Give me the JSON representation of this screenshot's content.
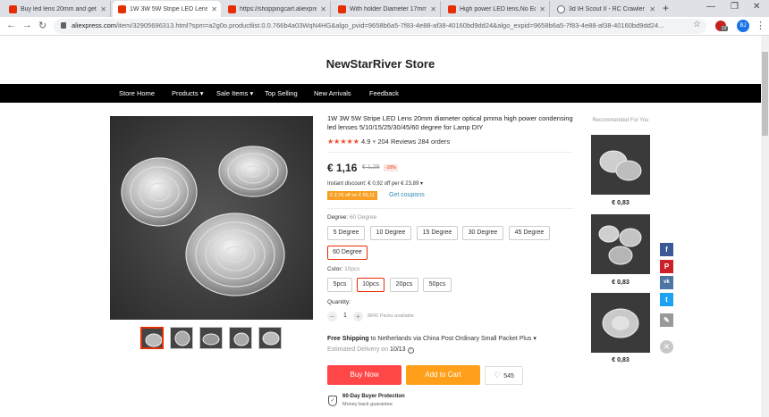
{
  "browser": {
    "tabs": [
      {
        "title": "Buy led lens 20mm and get fr",
        "icon": "aliexpress-icon"
      },
      {
        "title": "1W 3W 5W Stripe LED Lens 2",
        "icon": "aliexpress-icon"
      },
      {
        "title": "https://shoppingcart.aliexpres",
        "icon": "aliexpress-icon"
      },
      {
        "title": "With holder Diameter 17mm",
        "icon": "aliexpress-icon"
      },
      {
        "title": "High power LED lens,No Edg",
        "icon": "aliexpress-icon"
      },
      {
        "title": "3d IH Scout II - RC Crawler S",
        "icon": "globe-icon"
      }
    ],
    "url_host": "aliexpress.com",
    "url_rest": "/item/32905696313.html?spm=a2g0o.productlist.0.0.766b4a03WqN4HG&algo_pvid=9658b6a5-7f83-4e88-af38-40160bd9dd24&algo_expid=9658b6a5-7f83-4e88-af38-40160bd9dd24...",
    "extension_badge": "12",
    "profile_initials": "BJ"
  },
  "store": {
    "name": "NewStarRiver Store",
    "nav": [
      "Store Home",
      "Products",
      "Sale Items",
      "Top Selling",
      "New Arrivals",
      "Feedback"
    ]
  },
  "product": {
    "title": "1W 3W 5W Stripe LED Lens 20mm diameter optical pmma high power condensing led lenses 5/10/15/25/30/45/60 degree for Lamp DIY",
    "stars": "★★★★★",
    "rating": "4.9",
    "reviews": "204 Reviews",
    "orders": "284 orders",
    "price": "€ 1,16",
    "old_price": "€ 1,29",
    "discount": "-10%",
    "instant_discount": "Instant discount: € 0,92 off per € 23,89",
    "coupon_tag": "€ 2,76 off on € 55,11",
    "coupon_link": "Get coupons",
    "degree_label": "Degree:",
    "degree_value": "60 Degree",
    "degrees": [
      "5 Degree",
      "10 Degree",
      "15 Degree",
      "30 Degree",
      "45 Degree",
      "60 Degree"
    ],
    "color_label": "Color:",
    "color_value": "10pcs",
    "colors": [
      "5pcs",
      "10pcs",
      "20pcs",
      "50pcs"
    ],
    "quantity_label": "Quantity:",
    "qty_minus": "−",
    "qty_plus": "+",
    "quantity": "1",
    "available": "8842 Packs available",
    "shipping_bold": "Free Shipping",
    "shipping_rest": "to Netherlands via China Post Ordinary Small Packet Plus",
    "delivery_label": "Estimated Delivery on",
    "delivery_date": "10/13",
    "buy_now": "Buy Now",
    "add_to_cart": "Add to Cart",
    "wishlist_count": "545",
    "protection_title": "60-Day Buyer Protection",
    "protection_sub": "Money back guarantee"
  },
  "recommended": {
    "title": "Recommended For You",
    "prices": [
      "€ 0,83",
      "€ 0,83",
      "€ 0,83"
    ]
  },
  "share": [
    {
      "name": "facebook-icon",
      "glyph": "f",
      "color": "#3b5998"
    },
    {
      "name": "pinterest-icon",
      "glyph": "P",
      "color": "#cb2027"
    },
    {
      "name": "vk-icon",
      "glyph": "vk",
      "color": "#4c75a3"
    },
    {
      "name": "twitter-icon",
      "glyph": "t",
      "color": "#1da1f2"
    },
    {
      "name": "edit-icon",
      "glyph": "✎",
      "color": "#999999"
    }
  ],
  "colors": {
    "brand": "#e62e04",
    "buy": "#ff4747",
    "cart": "#ff9f1a",
    "link": "#2c8eb8"
  }
}
